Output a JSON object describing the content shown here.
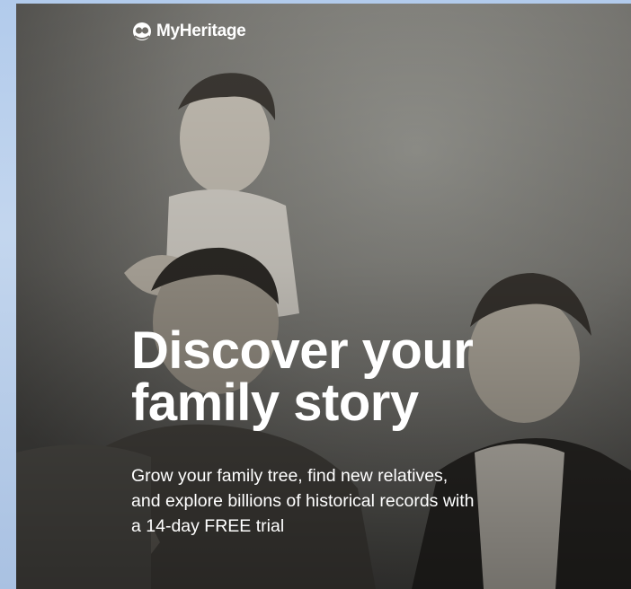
{
  "brand": {
    "name": "MyHeritage",
    "logo_icon": "myheritage-logo-icon",
    "color": "#ffffff"
  },
  "hero": {
    "headline_line1": "Discover your",
    "headline_line2": "family story",
    "subtext_line1": "Grow your family tree, find new relatives,",
    "subtext_line2": "and explore billions of historical records with",
    "subtext_line3": "a 14-day FREE trial",
    "image": "vintage-family-photo"
  }
}
